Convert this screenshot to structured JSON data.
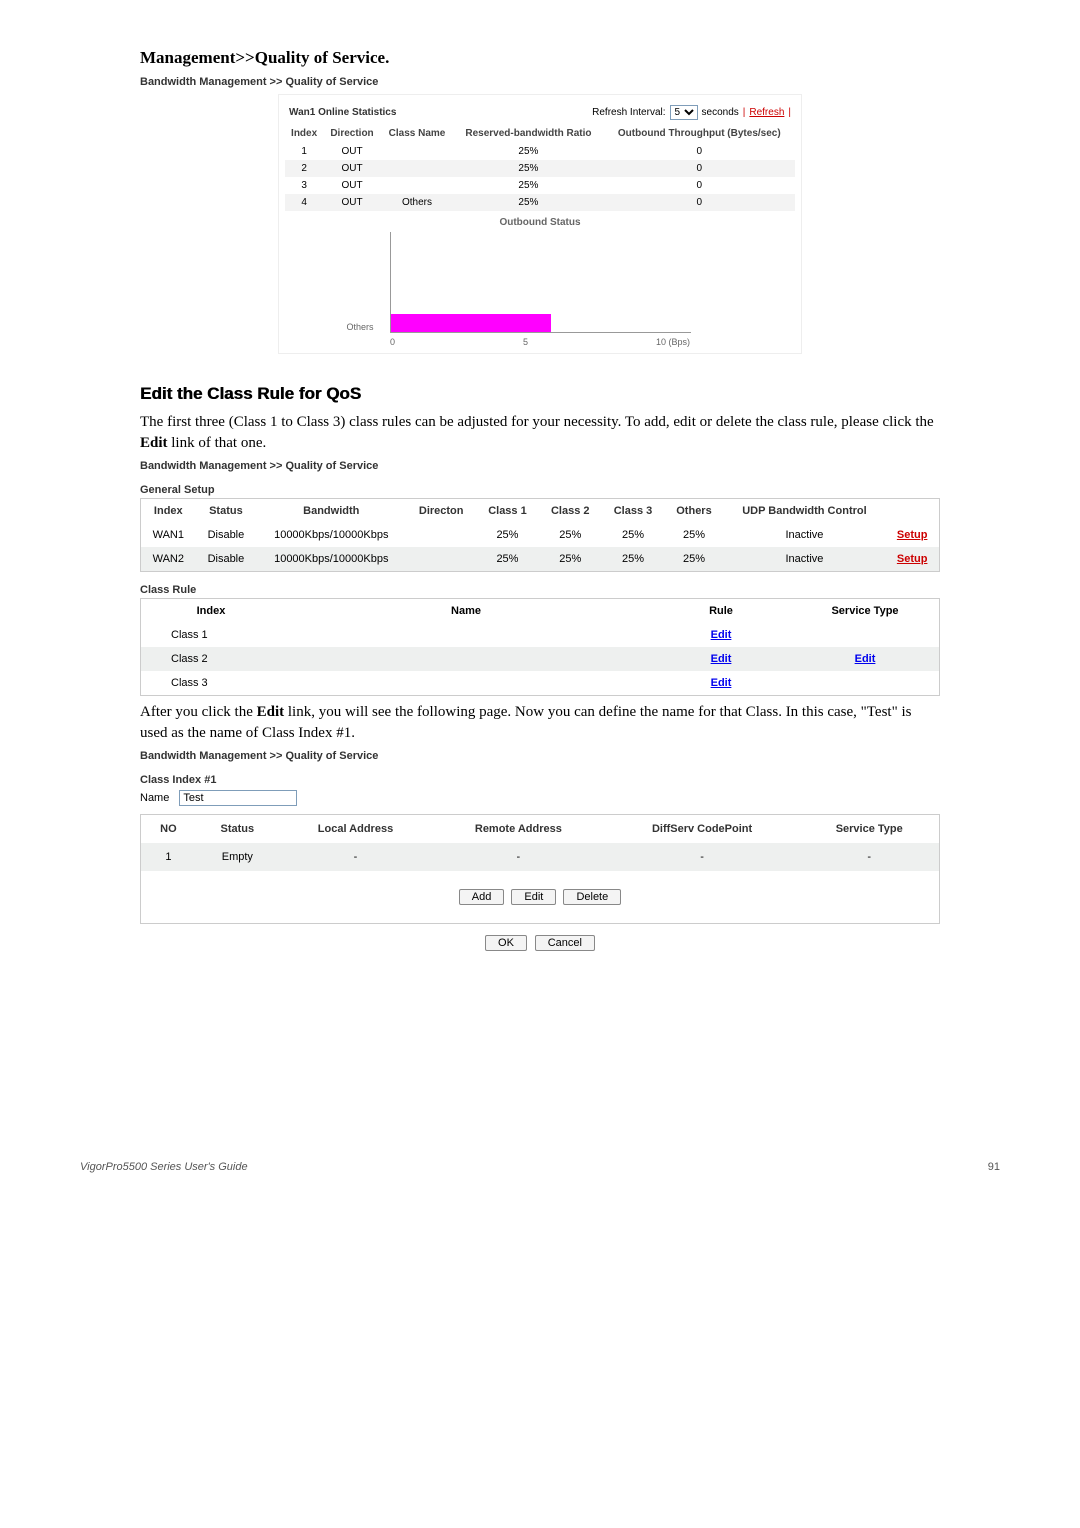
{
  "head": {
    "title_pre": "Management>>Quality of Service",
    "title_post": ".",
    "sub": "Bandwidth Management >> Quality of Service"
  },
  "panel1": {
    "title": "Wan1 Online Statistics",
    "refresh_label": "Refresh Interval:",
    "refresh_value": "5",
    "seconds": "seconds",
    "pipe1": "|",
    "refresh": "Refresh",
    "pipe2": "|",
    "head": {
      "index": "Index",
      "dir": "Direction",
      "cn": "Class Name",
      "rb": "Reserved-bandwidth Ratio",
      "ot": "Outbound Throughput (Bytes/sec)"
    },
    "rows": [
      {
        "idx": "1",
        "dir": "OUT",
        "cn": "",
        "rb": "25%",
        "ot": "0"
      },
      {
        "idx": "2",
        "dir": "OUT",
        "cn": "",
        "rb": "25%",
        "ot": "0"
      },
      {
        "idx": "3",
        "dir": "OUT",
        "cn": "",
        "rb": "25%",
        "ot": "0"
      },
      {
        "idx": "4",
        "dir": "OUT",
        "cn": "Others",
        "rb": "25%",
        "ot": "0"
      }
    ]
  },
  "chart_data": {
    "type": "bar",
    "title": "Outbound Status",
    "categories": [
      "Others"
    ],
    "values": [
      5
    ],
    "xlabel": "",
    "ylabel": "Others",
    "xlim": [
      0,
      10
    ],
    "xticks": [
      "0",
      "5",
      "10 (Bps)"
    ]
  },
  "section_edit": {
    "title": "Edit the Class Rule for QoS",
    "t1a": "The first three (Class 1 to Class 3) class rules can be adjusted for your necessity. To add, edit or delete the class rule, please click the ",
    "t1b": "Edit",
    "t1c": " link of that one.",
    "sub": "Bandwidth Management >> Quality of Service",
    "gen": "General Setup"
  },
  "gen_table": {
    "h": {
      "idx": "Index",
      "st": "Status",
      "bw": "Bandwidth",
      "dir": "Directon",
      "c1": "Class 1",
      "c2": "Class 2",
      "c3": "Class 3",
      "oth": "Others",
      "udp": "UDP Bandwidth Control",
      "blank": ""
    },
    "rows": [
      {
        "idx": "WAN1",
        "st": "Disable",
        "bw": "10000Kbps/10000Kbps",
        "dir": "",
        "c1": "25%",
        "c2": "25%",
        "c3": "25%",
        "oth": "25%",
        "udp": "Inactive",
        "sp": "Setup"
      },
      {
        "idx": "WAN2",
        "st": "Disable",
        "bw": "10000Kbps/10000Kbps",
        "dir": "",
        "c1": "25%",
        "c2": "25%",
        "c3": "25%",
        "oth": "25%",
        "udp": "Inactive",
        "sp": "Setup"
      }
    ]
  },
  "rule_table": {
    "title": "Class Rule",
    "h": {
      "idx": "Index",
      "name": "Name",
      "rule": "Rule",
      "svc": "Service Type"
    },
    "rows": [
      {
        "idx": "Class 1",
        "name": "",
        "rule": "Edit",
        "svc": ""
      },
      {
        "idx": "Class 2",
        "name": "",
        "rule": "Edit",
        "svc": "Edit"
      },
      {
        "idx": "Class 3",
        "name": "",
        "rule": "Edit",
        "svc": ""
      }
    ]
  },
  "body2": {
    "t1a": "After you click the ",
    "t1b": "Edit",
    "t1c": " link, you will see the following page. Now you can define the name for that Class. In this case, \"Test\" is used as the name of Class Index #1.",
    "sub": "Bandwidth Management >> Quality of Service"
  },
  "classidx": {
    "label": "Class Index #1",
    "name_lbl": "Name",
    "name_val": "Test",
    "h": {
      "no": "NO",
      "st": "Status",
      "la": "Local Address",
      "ra": "Remote Address",
      "dc": "DiffServ CodePoint",
      "svc": "Service Type"
    },
    "row": {
      "no": "1",
      "st": "Empty",
      "la": "-",
      "ra": "-",
      "dc": "-",
      "svc": "-"
    },
    "btn": {
      "add": "Add",
      "edit": "Edit",
      "del": "Delete",
      "ok": "OK",
      "cancel": "Cancel"
    }
  },
  "footer": {
    "left": "VigorPro5500 Series User's Guide",
    "right": "91"
  }
}
